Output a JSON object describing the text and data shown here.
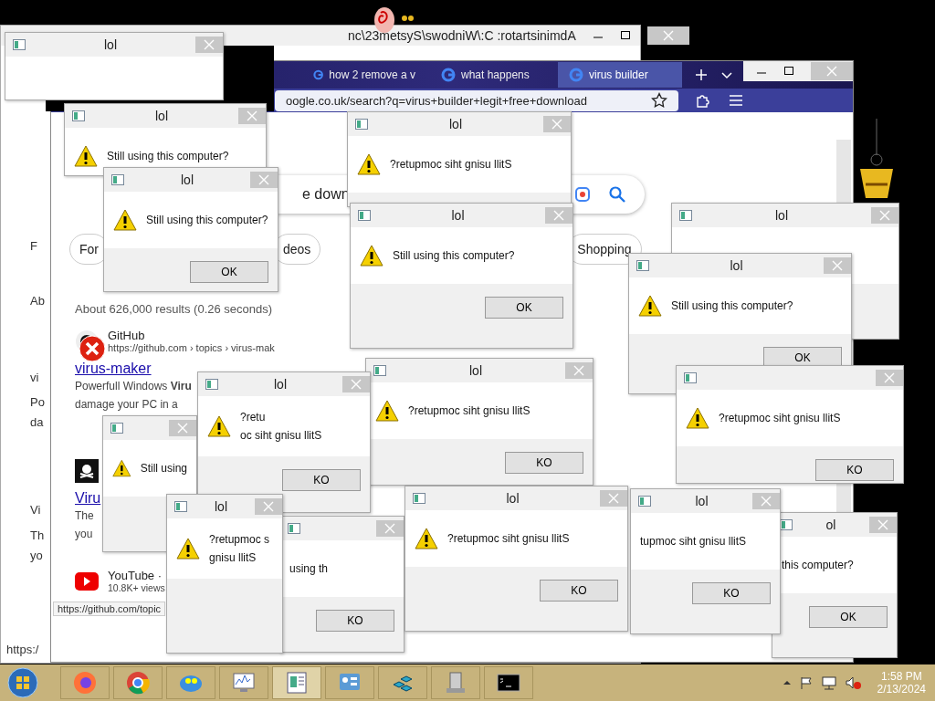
{
  "back_window": {
    "title": "nc\\23metsyS\\swodniW\\:C :rotartsinimdA"
  },
  "ghost_text": [
    "F",
    "Ab",
    "vi",
    "Po",
    "da",
    "Vi",
    "Th",
    "yo",
    "https:/"
  ],
  "browser": {
    "tabs": [
      {
        "label": "how 2 remove a v",
        "selected": false
      },
      {
        "label": "what happens",
        "selected": false
      },
      {
        "label": "virus builder",
        "selected": true
      }
    ],
    "url": "oogle.co.uk/search?q=virus+builder+legit+free+download",
    "search_value": "e down",
    "chips": [
      "For",
      "deos",
      "Shopping"
    ],
    "result_count": "About 626,000 results (0.26 seconds)",
    "results": [
      {
        "kind": "github",
        "source": "GitHub",
        "url": "https://github.com › topics › virus-mak",
        "title": "virus-maker",
        "lines": [
          "Powerfull Windows **Viru**",
          "damage your PC in a"
        ]
      },
      {
        "kind": "pirate",
        "title": "Viru",
        "lines": [
          "The",
          "you"
        ]
      },
      {
        "kind": "youtube",
        "source": "YouTube · ",
        "url": "10.8K+ views"
      }
    ],
    "status": "https://github.com/topic"
  },
  "dialogs": [
    {
      "title": "lol",
      "warning": false
    },
    {
      "title": "lol",
      "warning": true,
      "lines": [
        "Still using this computer?"
      ]
    },
    {
      "title": "lol",
      "warning": true,
      "lines": [
        "Still using this computer?"
      ],
      "button": "OK"
    },
    {
      "title": "lol",
      "warning": true,
      "lines": [
        "?retupmoc siht gnisu llitS"
      ]
    },
    {
      "title": "lol",
      "warning": false
    },
    {
      "title": "lol",
      "warning": true,
      "lines": [
        "Still using this computer?"
      ],
      "button": "OK"
    },
    {
      "title": "lol",
      "warning": true,
      "lines": [
        "Still using this computer?"
      ],
      "button": "OK"
    },
    {
      "warning": true,
      "lines": [
        "?retupmoc siht gnisu llitS"
      ],
      "button": "KO"
    },
    {
      "title": "lol",
      "warning": true,
      "lines": [
        "?retupmoc siht gnisu llitS"
      ],
      "button": "KO"
    },
    {
      "warning": true,
      "lines": [
        "Still using"
      ]
    },
    {
      "title": "lol",
      "warning": true,
      "lines": [
        "?retu",
        "oc siht gnisu llitS"
      ],
      "button": "KO"
    },
    {
      "warning": false,
      "lines": [
        "using th"
      ],
      "button": "KO"
    },
    {
      "title": "lol",
      "warning": true,
      "lines": [
        "?retupmoc s",
        "gnisu llitS"
      ]
    },
    {
      "title": "ol",
      "warning": false,
      "lines": [
        "this computer?"
      ],
      "button": "OK"
    },
    {
      "title": "lol",
      "warning": true,
      "lines": [
        "?retupmoc siht gnisu llitS"
      ],
      "button": "KO"
    },
    {
      "title": "lol",
      "warning": false,
      "lines": [
        "tupmoc siht gnisu llitS"
      ],
      "button": "KO"
    }
  ],
  "taskbar": {
    "apps": [
      {
        "kind": "firefox",
        "selected": false
      },
      {
        "kind": "chrome",
        "selected": false
      },
      {
        "kind": "mascot",
        "selected": false
      },
      {
        "kind": "monitor",
        "selected": false
      },
      {
        "kind": "document",
        "selected": true
      },
      {
        "kind": "panel",
        "selected": false
      },
      {
        "kind": "cubes",
        "selected": false
      },
      {
        "kind": "drive",
        "selected": false
      },
      {
        "kind": "terminal",
        "selected": false
      }
    ],
    "time": "1:58 PM",
    "date": "2/13/2024"
  }
}
